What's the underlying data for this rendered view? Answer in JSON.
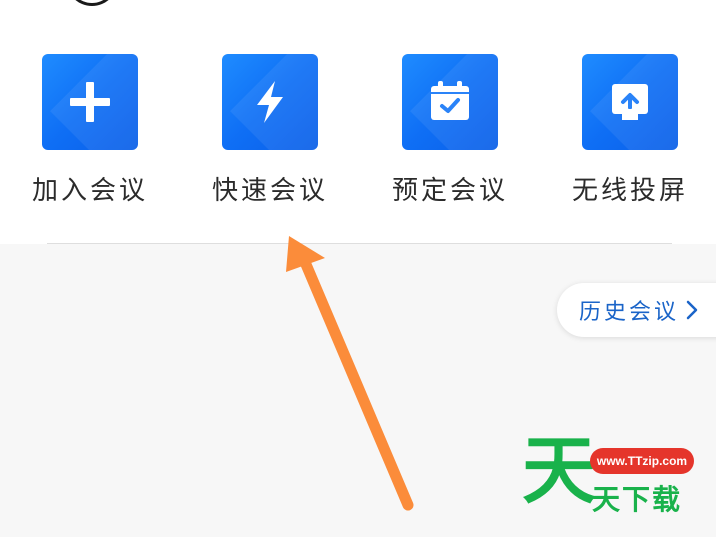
{
  "actions": [
    {
      "label": "加入会议",
      "icon": "plus-icon"
    },
    {
      "label": "快速会议",
      "icon": "lightning-icon"
    },
    {
      "label": "预定会议",
      "icon": "calendar-check-icon"
    },
    {
      "label": "无线投屏",
      "icon": "screen-cast-icon"
    }
  ],
  "history_button": {
    "label": "历史会议",
    "icon": "chevron-right-icon"
  },
  "watermark": {
    "big": "天",
    "url": "www.TTzip.com",
    "text": "天下载"
  },
  "colors": {
    "tile_blue": "#0f6ff5",
    "link_blue": "#1a64c8",
    "arrow_orange": "#fb8c3a",
    "watermark_green": "#19b24b",
    "watermark_red": "#e5352b"
  }
}
